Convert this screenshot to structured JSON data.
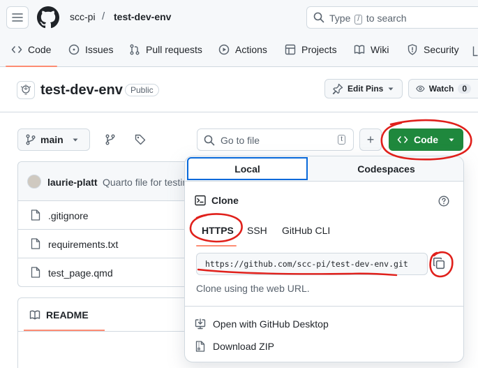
{
  "header": {
    "owner": "scc-pi",
    "separator": "/",
    "repo": "test-dev-env",
    "search_prefix": "Type",
    "search_key": "/",
    "search_suffix": "to search"
  },
  "nav": {
    "items": [
      {
        "label": "Code",
        "icon": "code-icon"
      },
      {
        "label": "Issues",
        "icon": "issue-opened-icon"
      },
      {
        "label": "Pull requests",
        "icon": "git-pull-request-icon"
      },
      {
        "label": "Actions",
        "icon": "play-icon"
      },
      {
        "label": "Projects",
        "icon": "table-icon"
      },
      {
        "label": "Wiki",
        "icon": "book-icon"
      },
      {
        "label": "Security",
        "icon": "shield-icon"
      }
    ]
  },
  "repo": {
    "name": "test-dev-env",
    "visibility": "Public",
    "edit_pins": "Edit Pins",
    "watch": "Watch",
    "watch_count": "0"
  },
  "toolbar": {
    "branch": "main",
    "goto_placeholder": "Go to file",
    "goto_key": "t",
    "plus": "+",
    "code_button": "Code"
  },
  "commit": {
    "author": "laurie-platt",
    "message": "Quarto file for testing"
  },
  "files": [
    {
      "name": ".gitignore"
    },
    {
      "name": "requirements.txt"
    },
    {
      "name": "test_page.qmd"
    }
  ],
  "readme": {
    "title": "README"
  },
  "clone_popover": {
    "tabs": {
      "local": "Local",
      "codespaces": "Codespaces"
    },
    "heading": "Clone",
    "protocols": {
      "https": "HTTPS",
      "ssh": "SSH",
      "cli": "GitHub CLI"
    },
    "url": "https://github.com/scc-pi/test-dev-env.git",
    "note": "Clone using the web URL.",
    "actions": {
      "desktop": "Open with GitHub Desktop",
      "zip": "Download ZIP"
    }
  },
  "colors": {
    "accent_green": "#1f883d",
    "tab_focus": "#0969da",
    "underline": "#fd8c73",
    "annotation_red": "#e0201b"
  }
}
